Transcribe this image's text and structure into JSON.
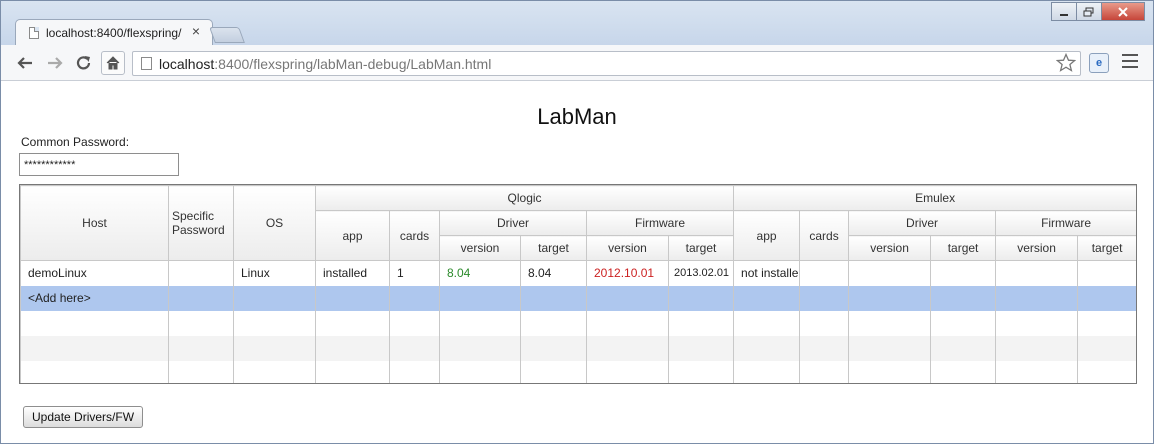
{
  "browser": {
    "tab_title": "localhost:8400/flexspring/",
    "tab_close": "×",
    "url_host": "localhost",
    "url_rest": ":8400/flexspring/labMan-debug/LabMan.html",
    "icons": [
      "page-icon",
      "back-icon",
      "forward-icon",
      "reload-icon",
      "home-icon",
      "star-icon",
      "extension-icon",
      "menu-icon"
    ]
  },
  "app": {
    "title": "LabMan",
    "password_label": "Common Password:",
    "password_value": "************",
    "update_button": "Update Drivers/FW"
  },
  "grid": {
    "headers": {
      "host": "Host",
      "specific_password": "Specific Password",
      "os": "OS",
      "qlogic": "Qlogic",
      "emulex": "Emulex",
      "app": "app",
      "cards": "cards",
      "driver": "Driver",
      "firmware": "Firmware",
      "version": "version",
      "target": "target"
    },
    "rows": [
      {
        "host": "demoLinux",
        "specific_password": "",
        "os": "Linux",
        "q_app": "installed",
        "q_cards": "1",
        "q_driver_version": "8.04",
        "q_driver_target": "8.04",
        "q_fw_version": "2012.10.01",
        "q_fw_target": "2013.02.01",
        "e_app": "not installe",
        "e_cards": "",
        "e_driver_version": "",
        "e_driver_target": "",
        "e_fw_version": "",
        "e_fw_target": ""
      },
      {
        "host": "<Add here>",
        "specific_password": "",
        "os": "",
        "q_app": "",
        "q_cards": "",
        "q_driver_version": "",
        "q_driver_target": "",
        "q_fw_version": "",
        "q_fw_target": "",
        "e_app": "",
        "e_cards": "",
        "e_driver_version": "",
        "e_driver_target": "",
        "e_fw_version": "",
        "e_fw_target": ""
      }
    ],
    "colors": {
      "ok": "#2b8a2b",
      "outdated": "#cc2222",
      "selection": "#aec7ee"
    }
  }
}
